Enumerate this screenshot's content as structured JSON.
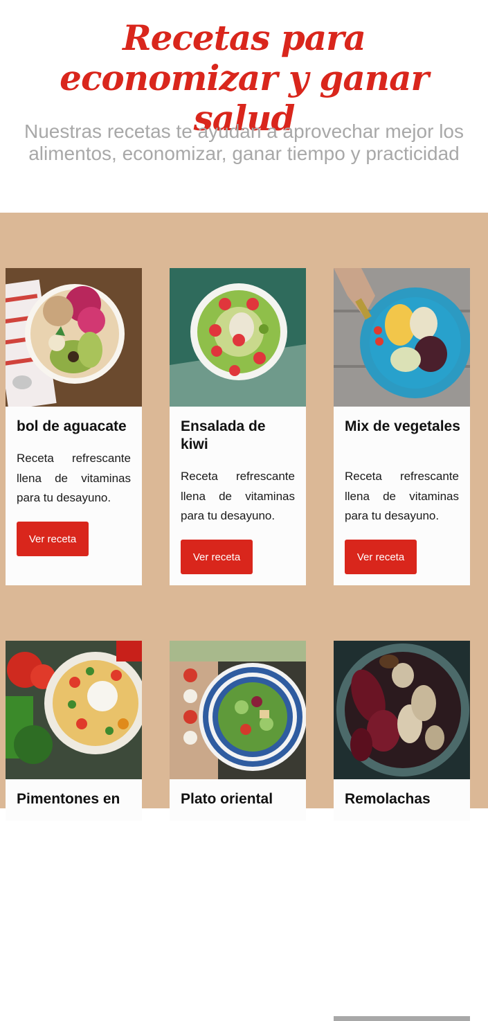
{
  "hero": {
    "title": "Recetas para economizar y ganar salud",
    "subtitle": "Nuestras recetas te ayudan a aprovechar mejor los alimentos, economizar, ganar tiempo y practicidad"
  },
  "recipes": [
    {
      "title": "bol de aguacate",
      "description": "Receta refrescante llena de vitaminas para tu desayuno.",
      "button_label": "Ver receta",
      "image_icon": "avocado-bowl-photo"
    },
    {
      "title": "Ensalada de kiwi",
      "description": "Receta refrescante llena de vitaminas para tu desayuno.",
      "button_label": "Ver receta",
      "image_icon": "kiwi-bowl-photo"
    },
    {
      "title": "Mix de vegetales",
      "description": "Receta refrescante llena de vitaminas para tu desayuno.",
      "button_label": "Ver receta",
      "image_icon": "vegetable-mix-photo"
    },
    {
      "title": "Pimentones en",
      "image_icon": "pepper-salad-photo"
    },
    {
      "title": "Plato oriental",
      "image_icon": "oriental-salad-photo"
    },
    {
      "title": "Remolachas",
      "image_icon": "roasted-beets-photo"
    }
  ],
  "colors": {
    "accent": "#d9261c",
    "section_background": "#dbb896",
    "card_background": "#fcfcfc",
    "subtitle_text": "#a8a8a8"
  }
}
